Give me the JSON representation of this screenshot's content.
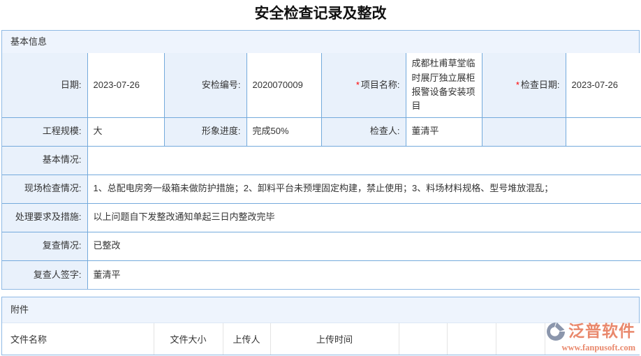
{
  "page": {
    "title": "安全检查记录及整改"
  },
  "required_mark": "*",
  "basic": {
    "header": "基本信息",
    "fields": {
      "date": {
        "label": "日期:",
        "value": "2023-07-26"
      },
      "inspection_no": {
        "label": "安检编号:",
        "value": "2020070009"
      },
      "project_name": {
        "label": "项目名称:",
        "value": "成都杜甫草堂临时展厅独立展柜报警设备安装项目",
        "required": true
      },
      "check_date": {
        "label": "检查日期:",
        "value": "2023-07-26",
        "required": true
      },
      "project_scale": {
        "label": "工程规模:",
        "value": "大"
      },
      "progress": {
        "label": "形象进度:",
        "value": "完成50%"
      },
      "inspector": {
        "label": "检查人:",
        "value": "董清平"
      },
      "basic_situation": {
        "label": "基本情况:",
        "value": ""
      },
      "site_check": {
        "label": "现场检查情况:",
        "value": "1、总配电房旁一级箱未做防护措施；2、卸料平台未预埋固定构建，禁止使用；3、料场材料规格、型号堆放混乱；"
      },
      "measures": {
        "label": "处理要求及措施:",
        "value": "以上问题自下发整改通知单起三日内整改完毕"
      },
      "recheck": {
        "label": "复查情况:",
        "value": "已整改"
      },
      "recheck_sign": {
        "label": "复查人签字:",
        "value": "董清平"
      }
    }
  },
  "attachments": {
    "header": "附件",
    "columns": [
      "文件名称",
      "文件大小",
      "上传人",
      "上传时间"
    ]
  },
  "watermark": {
    "brand": "泛普软件",
    "url": "www.fanpusoft.com"
  },
  "colors": {
    "table_border_blue": "#74aadc",
    "section_border_blue": "#8fb9e4",
    "label_cell_bg": "#e9f1fb",
    "section_header_bg": "#eef4fd",
    "required_red": "#ff0000",
    "watermark_coral": "#e77e5f",
    "watermark_logo_gray": "#8b96ac",
    "attach_divider_gray": "#e4e4e4"
  }
}
